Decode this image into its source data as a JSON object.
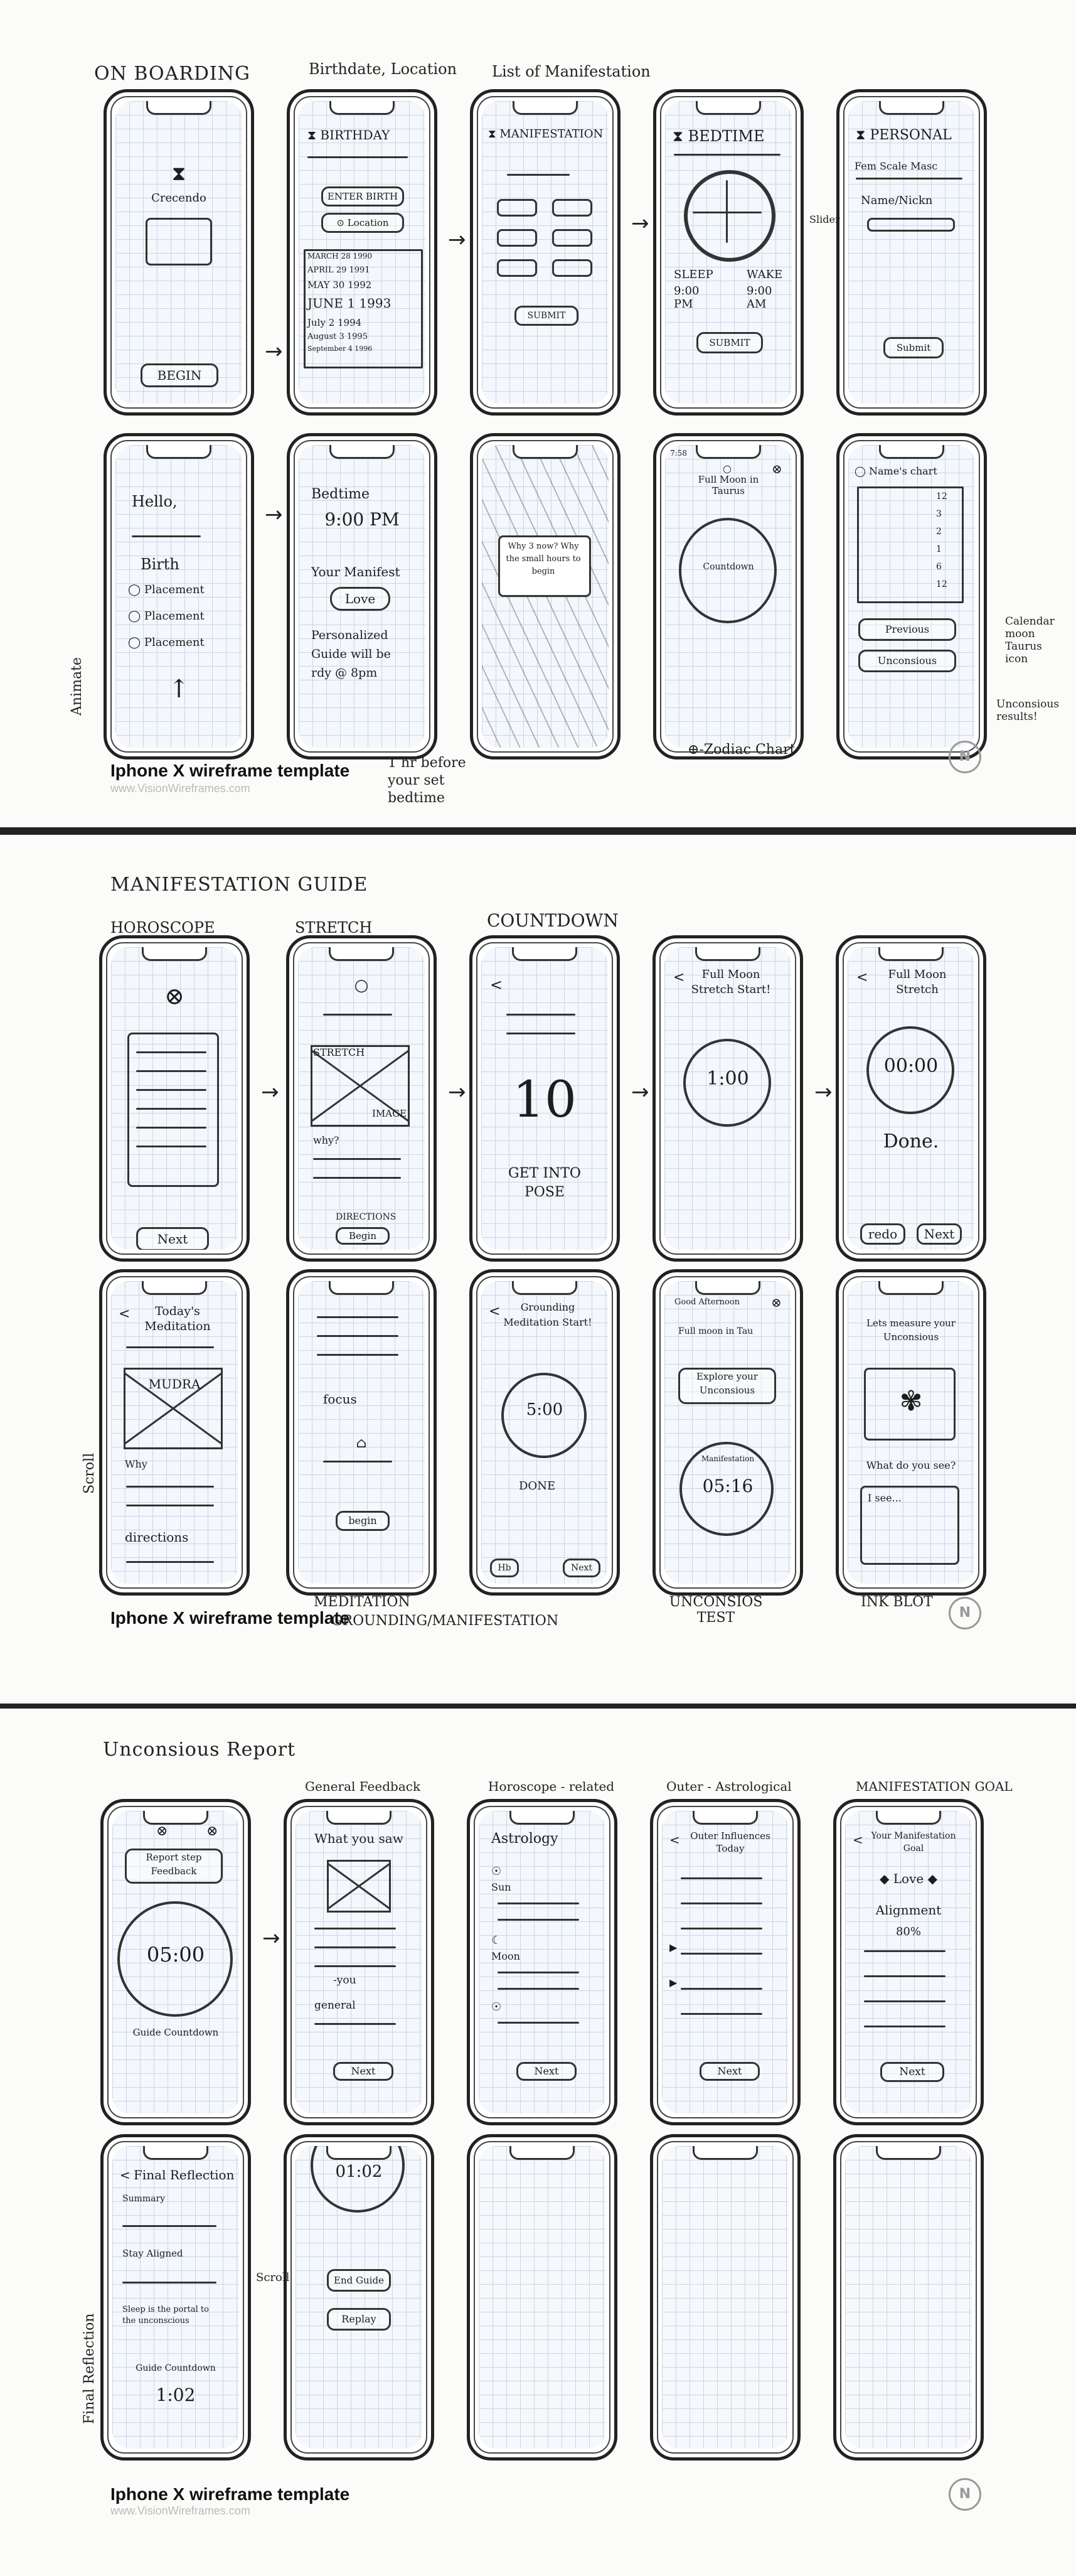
{
  "sheet1": {
    "title": "ON BOARDING",
    "labels": [
      "Birthdate, Location",
      "List of Manifestation"
    ],
    "side_note": "Animate",
    "bottom_notes": [
      "1 hr before your set bedtime",
      "⊕-Zodiac Chart",
      "Unconsious results!"
    ],
    "footer": "Iphone X wireframe template",
    "footer_sub": "www.VisionWireframes.com",
    "phones": {
      "p1": {
        "caption": "Crecendo",
        "button": "BEGIN"
      },
      "p2": {
        "title": "BIRTHDAY",
        "enter": "ENTER BIRTH",
        "location": "Location",
        "dates": [
          "MARCH 28 1990",
          "APRIL 29 1991",
          "MAY 30 1992",
          "JUNE 1 1993",
          "July 2 1994",
          "August 3 1995",
          "September 4 1996"
        ]
      },
      "p3": {
        "title": "MANIFESTATION",
        "button": "SUBMIT"
      },
      "p4": {
        "title": "BEDTIME",
        "sleep": "SLEEP",
        "wake": "WAKE",
        "sleep_time": "9:00 PM",
        "wake_time": "9:00 AM",
        "button": "SUBMIT",
        "side": "Slider"
      },
      "p5": {
        "title": "PERSONAL",
        "scale": "Fem Scale Masc",
        "name": "Name/Nickn",
        "button": "Submit"
      },
      "p6": {
        "hello": "Hello,",
        "birth": "Birth",
        "placements": [
          "Placement",
          "Placement",
          "Placement"
        ]
      },
      "p7": {
        "bedtime": "Bedtime",
        "time": "9:00 PM",
        "manifest": "Your Manifest",
        "love": "Love",
        "guide": "Personalized Guide will be rdy @ 8pm"
      },
      "p8": {
        "popup": "Why 3 now? Why the small hours to begin"
      },
      "p9": {
        "time": "7:58",
        "moon": "Full Moon in Taurus",
        "countdown": "Countdown"
      },
      "p10": {
        "title": "Name's chart",
        "rows": [
          "12",
          "3",
          "2",
          "1",
          "6",
          "12"
        ],
        "previous": "Previous",
        "unconscious": "Unconsious",
        "side": "Calendar moon Taurus icon"
      }
    }
  },
  "sheet2": {
    "title": "MANIFESTATION GUIDE",
    "labels": [
      "HOROSCOPE",
      "STRETCH",
      "COUNTDOWN"
    ],
    "side_note": "Scroll",
    "bottom_notes": [
      "MEDITATION",
      "GROUNDING/MANIFESTATION",
      "UNCONSIOS TEST",
      "INK BLOT"
    ],
    "footer": "Iphone X wireframe template",
    "phones": {
      "p1": {
        "button": "Next"
      },
      "p2": {
        "stretch": "STRETCH",
        "image": "IMAGE",
        "why": "why?",
        "directions": "DIRECTIONS",
        "begin": "Begin"
      },
      "p3": {
        "number": "10",
        "caption": "GET INTO POSE"
      },
      "p4": {
        "title": "Full Moon Stretch Start!",
        "timer": "1:00"
      },
      "p5": {
        "title": "Full Moon Stretch",
        "timer": "00:00",
        "done": "Done.",
        "redo": "redo",
        "next": "Next"
      },
      "p6": {
        "title": "Today's Meditation",
        "mudra": "MUDRA",
        "why": "Why",
        "directions": "directions"
      },
      "p7": {
        "focus": "focus",
        "begin": "begin"
      },
      "p8": {
        "title": "Grounding Meditation Start!",
        "timer": "5:00",
        "done": "DONE",
        "skip": "Hb",
        "next": "Next"
      },
      "p9": {
        "greeting": "Good Afternoon",
        "moon": "Full moon in Tau",
        "explore": "Explore your Unconsious",
        "label": "Manifestation",
        "timer": "05:16"
      },
      "p10": {
        "title": "Lets measure your Unconsious",
        "question": "What do you see?",
        "answer": "I see..."
      }
    }
  },
  "sheet3": {
    "title": "Unconsious Report",
    "labels": [
      "General Feedback",
      "Horoscope - related",
      "Outer - Astrological",
      "MANIFESTATION GOAL"
    ],
    "side_note": "Final Reflection",
    "scroll_note": "Scroll",
    "footer": "Iphone X wireframe template",
    "footer_sub": "www.VisionWireframes.com",
    "phones": {
      "p1": {
        "report": "Report step Feedback",
        "timer": "05:00",
        "guide": "Guide Countdown"
      },
      "p2": {
        "title": "What you saw",
        "you": "-you",
        "general": "general",
        "button": "Next"
      },
      "p3": {
        "title": "Astrology",
        "sun": "Sun",
        "moon": "Moon",
        "button": "Next"
      },
      "p4": {
        "title": "Outer Influences Today",
        "button": "Next"
      },
      "p5": {
        "title": "Your Manifestation Goal",
        "love": "Love",
        "alignment": "Alignment",
        "percent": "80%",
        "button": "Next"
      },
      "p6": {
        "title": "Final Reflection",
        "summary": "Summary",
        "align": "Stay Aligned",
        "sleep": "Sleep is the portal to the unconscious",
        "guide": "Guide Countdown",
        "timer": "1:02"
      },
      "p7": {
        "timer": "01:02",
        "end": "End Guide",
        "replay": "Replay"
      }
    }
  }
}
